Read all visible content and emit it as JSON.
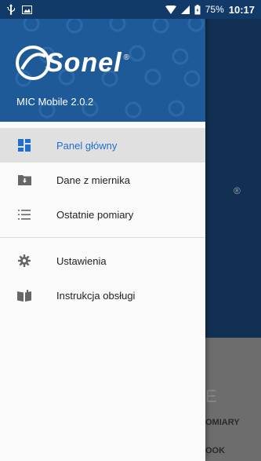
{
  "status_bar": {
    "battery": "75%",
    "time": "10:17"
  },
  "drawer": {
    "logo_text": "Sonel",
    "logo_reg": "®",
    "version": "MIC Mobile 2.0.2"
  },
  "menu": {
    "main": [
      {
        "label": "Panel główny",
        "icon": "dashboard-icon",
        "active": true
      },
      {
        "label": "Dane z miernika",
        "icon": "folder-download-icon",
        "active": false
      },
      {
        "label": "Ostatnie pomiary",
        "icon": "list-icon",
        "active": false
      }
    ],
    "secondary": [
      {
        "label": "Ustawienia",
        "icon": "gear-icon",
        "active": false
      },
      {
        "label": "Instrukcja obsługi",
        "icon": "book-icon",
        "active": false
      }
    ]
  },
  "background": {
    "reg_mark": "®",
    "bottom_letter": "E",
    "label_1": "OMIARY",
    "label_2": "OOK"
  },
  "colors": {
    "header": "#1f5a98",
    "accent": "#1f6fcf",
    "status_bar": "#123a68"
  }
}
